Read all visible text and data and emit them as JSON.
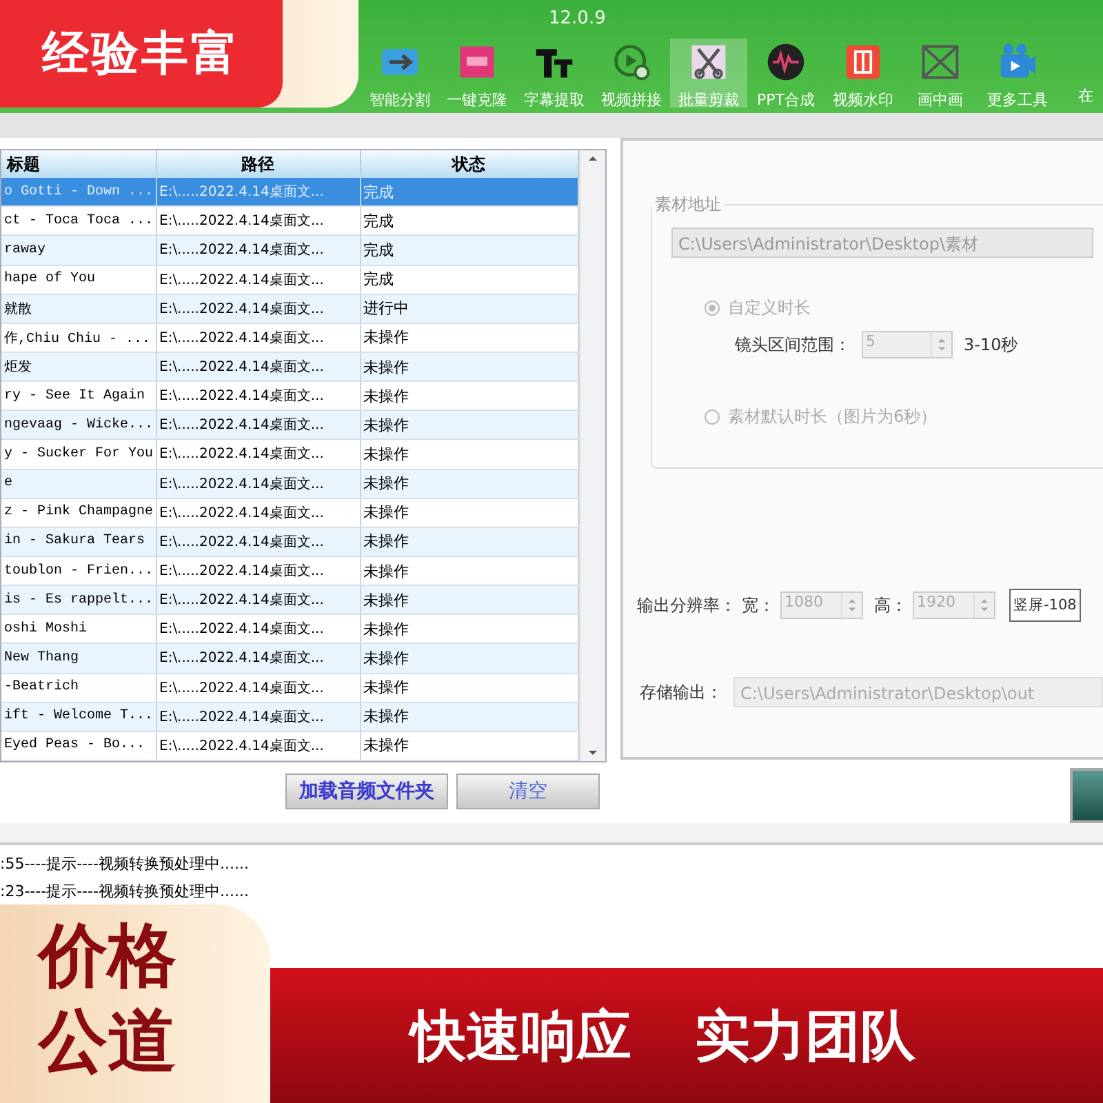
{
  "toolbar": {
    "version": "12.0.9",
    "tools": [
      {
        "label": "智能分割",
        "kind": "split",
        "selected": false
      },
      {
        "label": "一键克隆",
        "kind": "clone",
        "selected": false
      },
      {
        "label": "字幕提取",
        "kind": "text",
        "selected": false
      },
      {
        "label": "视频拼接",
        "kind": "join",
        "selected": false
      },
      {
        "label": "批量剪裁",
        "kind": "cut",
        "selected": true
      },
      {
        "label": "PPT合成",
        "kind": "ppt",
        "selected": false
      },
      {
        "label": "视频水印",
        "kind": "watermark",
        "selected": false
      },
      {
        "label": "画中画",
        "kind": "pip",
        "selected": false
      },
      {
        "label": "更多工具",
        "kind": "more",
        "selected": false
      },
      {
        "label": "在",
        "kind": "plain",
        "selected": false
      }
    ]
  },
  "file_list": {
    "columns": [
      "标题",
      "路径",
      "状态"
    ],
    "rows": [
      {
        "title": "o Gotti - Down ...",
        "path": "E:\\.....2022.4.14桌面文...",
        "status": "完成",
        "selected": true
      },
      {
        "title": "ct - Toca Toca ...",
        "path": "E:\\.....2022.4.14桌面文...",
        "status": "完成",
        "selected": false
      },
      {
        "title": "raway",
        "path": "E:\\.....2022.4.14桌面文...",
        "status": "完成",
        "selected": false
      },
      {
        "title": "hape of You",
        "path": "E:\\.....2022.4.14桌面文...",
        "status": "完成",
        "selected": false
      },
      {
        "title": "就散",
        "path": "E:\\.....2022.4.14桌面文...",
        "status": "进行中",
        "selected": false
      },
      {
        "title": "作,Chiu Chiu - ...",
        "path": "E:\\.....2022.4.14桌面文...",
        "status": "未操作",
        "selected": false
      },
      {
        "title": "炬发",
        "path": "E:\\.....2022.4.14桌面文...",
        "status": "未操作",
        "selected": false
      },
      {
        "title": "ry - See It Again",
        "path": "E:\\.....2022.4.14桌面文...",
        "status": "未操作",
        "selected": false
      },
      {
        "title": "ngevaag - Wicke...",
        "path": "E:\\.....2022.4.14桌面文...",
        "status": "未操作",
        "selected": false
      },
      {
        "title": "y - Sucker For You",
        "path": "E:\\.....2022.4.14桌面文...",
        "status": "未操作",
        "selected": false
      },
      {
        "title": "e",
        "path": "E:\\.....2022.4.14桌面文...",
        "status": "未操作",
        "selected": false
      },
      {
        "title": "z - Pink Champagne",
        "path": "E:\\.....2022.4.14桌面文...",
        "status": "未操作",
        "selected": false
      },
      {
        "title": "in - Sakura Tears",
        "path": "E:\\.....2022.4.14桌面文...",
        "status": "未操作",
        "selected": false
      },
      {
        "title": "toublon - Frien...",
        "path": "E:\\.....2022.4.14桌面文...",
        "status": "未操作",
        "selected": false
      },
      {
        "title": "is - Es rappelt...",
        "path": "E:\\.....2022.4.14桌面文...",
        "status": "未操作",
        "selected": false
      },
      {
        "title": "oshi Moshi",
        "path": "E:\\.....2022.4.14桌面文...",
        "status": "未操作",
        "selected": false
      },
      {
        "title": "New Thang",
        "path": "E:\\.....2022.4.14桌面文...",
        "status": "未操作",
        "selected": false
      },
      {
        "title": "-Beatrich",
        "path": "E:\\.....2022.4.14桌面文...",
        "status": "未操作",
        "selected": false
      },
      {
        "title": "ift - Welcome T...",
        "path": "E:\\.....2022.4.14桌面文...",
        "status": "未操作",
        "selected": false
      },
      {
        "title": "Eyed Peas - Bo...",
        "path": "E:\\.....2022.4.14桌面文...",
        "status": "未操作",
        "selected": false
      }
    ],
    "buttons": [
      "加载音频文件夹",
      "清空"
    ]
  },
  "settings": {
    "source_group": {
      "legend": "素材地址",
      "path": "C:\\Users\\Administrator\\Desktop\\素材",
      "duration_options": [
        {
          "label": "自定义时长",
          "checked": true
        },
        {
          "label": "素材默认时长（图片为6秒）",
          "checked": false
        }
      ],
      "range_label": "镜头区间范围：",
      "range_value": "5",
      "range_hint": "3-10秒"
    },
    "resolution_label": "输出分辨率：",
    "width_label": "宽：",
    "width_value": "1080",
    "height_label": "高：",
    "height_value": "1920",
    "preset": "竖屏-108",
    "output_label": "存储输出：",
    "output_path": "C:\\Users\\Administrator\\Desktop\\out"
  },
  "log": [
    ":55----提示----视频转换预处理中......",
    ":23----提示----视频转换预处理中......"
  ],
  "promo": {
    "top_badge": "经验丰富",
    "corner_badge": "价格公道",
    "slogans": [
      "快速响应",
      "实力团队"
    ]
  }
}
